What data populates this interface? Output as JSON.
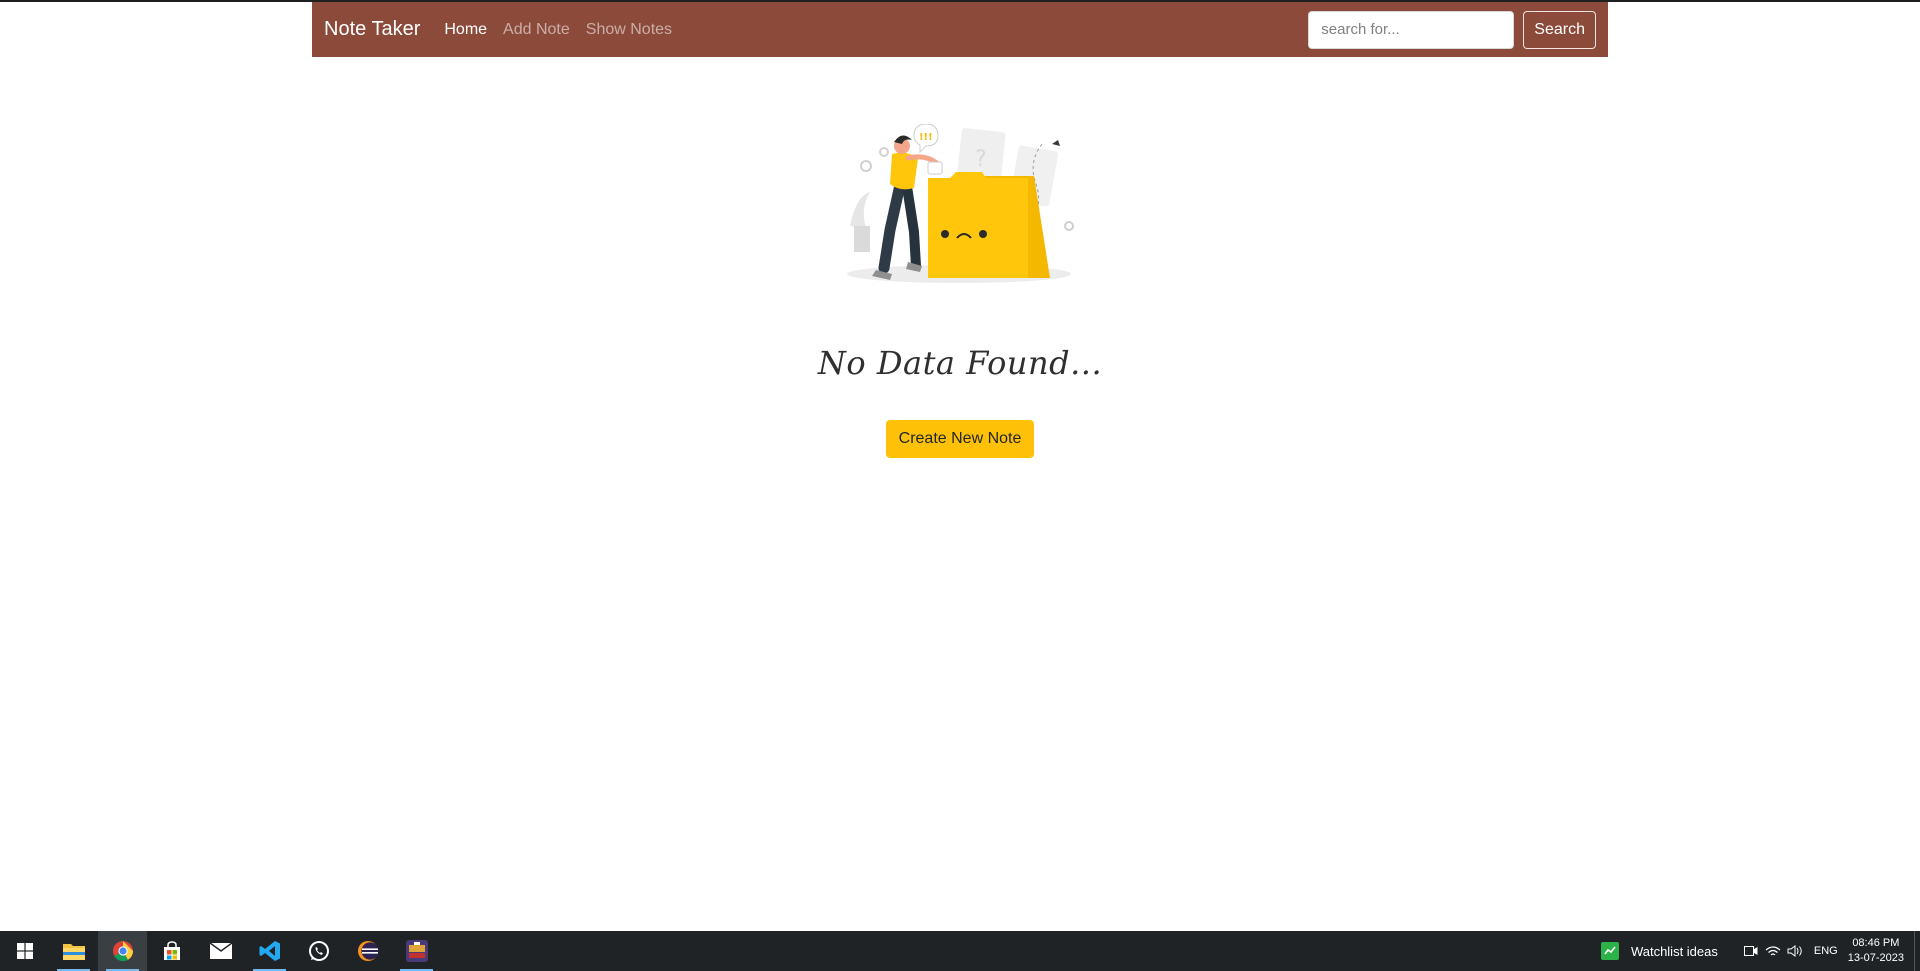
{
  "navbar": {
    "brand": "Note Taker",
    "links": [
      {
        "label": "Home",
        "active": true
      },
      {
        "label": "Add Note",
        "active": false
      },
      {
        "label": "Show Notes",
        "active": false
      }
    ],
    "search": {
      "placeholder": "search for...",
      "value": "",
      "button_label": "Search"
    },
    "background_color": "#8b4a3a"
  },
  "main": {
    "illustration_icon": "empty-folder-illustration",
    "empty_message": "No Data Found...",
    "create_button_label": "Create New Note",
    "accent_color": "#ffc107"
  },
  "taskbar": {
    "apps": [
      {
        "name": "start-icon",
        "active": false
      },
      {
        "name": "file-explorer-icon",
        "active": false,
        "running": true
      },
      {
        "name": "chrome-icon",
        "active": true,
        "running": true
      },
      {
        "name": "microsoft-store-icon",
        "active": false
      },
      {
        "name": "mail-icon",
        "active": false
      },
      {
        "name": "vscode-icon",
        "active": false,
        "running": true
      },
      {
        "name": "whatsapp-icon",
        "active": false
      },
      {
        "name": "eclipse-icon",
        "active": false
      },
      {
        "name": "game-app-icon",
        "active": false,
        "running": true
      }
    ],
    "tray": {
      "widget_label": "Watchlist ideas",
      "language": "ENG",
      "time": "08:46 PM",
      "date": "13-07-2023"
    }
  }
}
